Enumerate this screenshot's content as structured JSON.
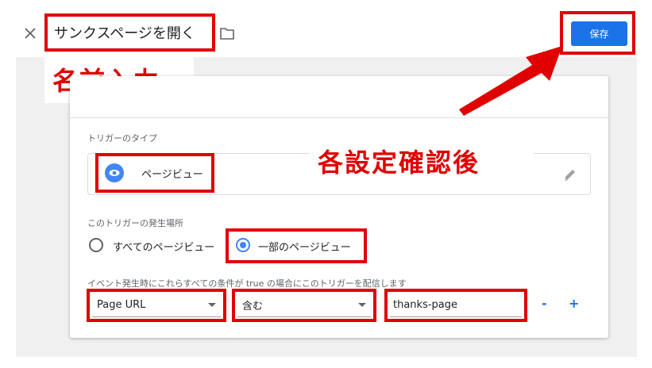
{
  "header": {
    "title": "サンクスページを開く",
    "save_label": "保存"
  },
  "annotations": {
    "name_input": "名前入力",
    "check_settings": "各設定確認後"
  },
  "trigger_type": {
    "label": "トリガーのタイプ",
    "value": "ページビュー"
  },
  "fire_on": {
    "label": "このトリガーの発生場所",
    "options": [
      "すべてのページビュー",
      "一部のページビュー"
    ],
    "selected_index": 1
  },
  "condition": {
    "label": "イベント発生時にこれらすべての条件が true の場合にこのトリガーを配信します",
    "variable": "Page URL",
    "operator": "含む",
    "value": "thanks-page",
    "minus_label": "-",
    "plus_label": "+"
  },
  "colors": {
    "accent": "#1a73e8",
    "annotation_red": "#e00000"
  }
}
